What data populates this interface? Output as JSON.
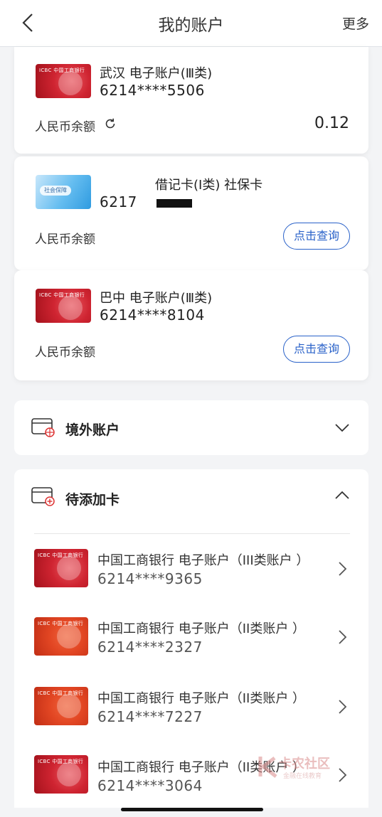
{
  "header": {
    "title": "我的账户",
    "more": "更多"
  },
  "accounts": [
    {
      "name": "武汉 电子账户(Ⅲ类)",
      "number": "6214****5506",
      "balance_label": "人民币余额",
      "balance_value": "0.12"
    },
    {
      "name": "借记卡(Ⅰ类) 社保卡",
      "number": "6217",
      "balance_label": "人民币余额",
      "query_label": "点击查询",
      "card_badge": "社会保障"
    },
    {
      "name": "巴中 电子账户(Ⅲ类)",
      "number": "6214****8104",
      "balance_label": "人民币余额",
      "query_label": "点击查询"
    }
  ],
  "overseas": {
    "title": "境外账户"
  },
  "pending": {
    "title": "待添加卡",
    "items": [
      {
        "name": "中国工商银行 电子账户（III类账户 ）",
        "number": "6214****9365",
        "card_color": "red"
      },
      {
        "name": "中国工商银行 电子账户（II类账户 ）",
        "number": "6214****2327",
        "card_color": "orange"
      },
      {
        "name": "中国工商银行 电子账户（II类账户 ）",
        "number": "6214****7227",
        "card_color": "orange"
      },
      {
        "name": "中国工商银行 电子账户（II类账户 ）",
        "number": "6214****3064",
        "card_color": "red"
      }
    ]
  },
  "card_logo_text": "ICBC 中国工商银行",
  "watermark": {
    "text": "卡农社区",
    "sub": "金融在线教育"
  },
  "colors": {
    "accent": "#2a62c9",
    "header_bg": "#ffffff",
    "page_bg": "#f3f4f6"
  },
  "icons": [
    "chevron-left-icon",
    "refresh-icon",
    "card-globe-icon",
    "card-add-icon",
    "chevron-down-icon",
    "chevron-up-icon",
    "chevron-right-icon"
  ]
}
